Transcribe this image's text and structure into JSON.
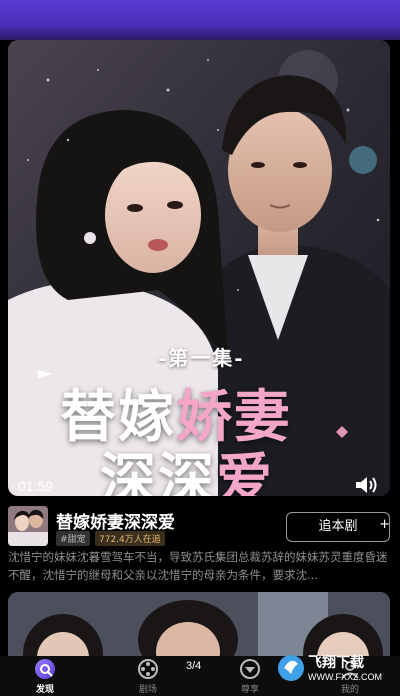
{
  "video": {
    "episode_tag": "-第一集-",
    "title_line1_part1": "替嫁",
    "title_line1_part2": "娇妻",
    "title_line2_part1": "深深",
    "title_line2_part2": "爱",
    "current_time": "01:59"
  },
  "drama": {
    "title": "替嫁娇妻深深爱",
    "genre_tag": "#甜宠",
    "viewers_tag": "772.4万人在追",
    "follow_label": "追本剧",
    "follow_plus": "+",
    "description": "沈惜宁的妹妹沈暮雪驾车不当，导致苏氏集团总裁苏辞的妹妹苏灵重度昏迷不醒，沈惜宁的继母和父亲以沈惜宁的母亲为条件，要求沈..."
  },
  "pager": {
    "indicator": "3/4"
  },
  "nav": {
    "items": [
      {
        "label": "发现",
        "icon": "discover-icon"
      },
      {
        "label": "剧场",
        "icon": "theater-icon"
      },
      {
        "label": "尊享",
        "icon": "vip-icon"
      },
      {
        "label": "我的",
        "icon": "profile-icon"
      }
    ]
  },
  "watermark": {
    "text": "飞翔下载",
    "url": "WWW.FXXZ.COM"
  },
  "colors": {
    "accent_purple": "#5a3bd6",
    "title_pink": "#f3a6c8",
    "viewers_gold": "#e7b86f"
  }
}
